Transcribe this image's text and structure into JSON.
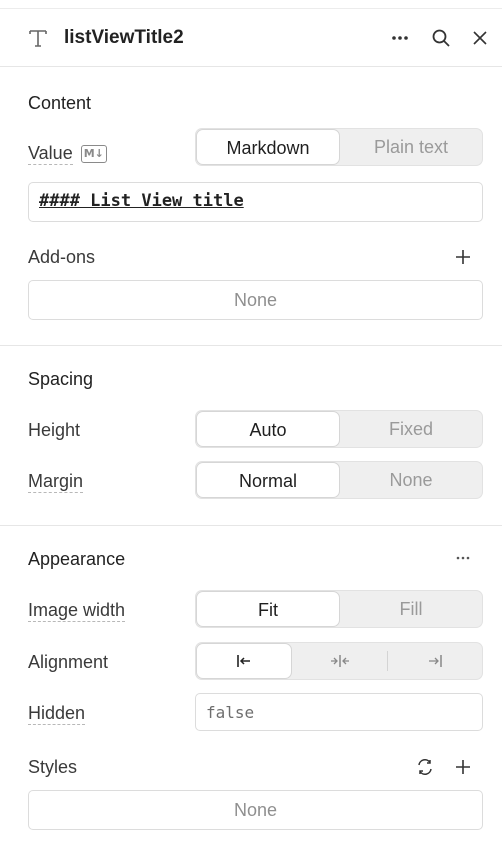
{
  "header": {
    "title": "listViewTitle2",
    "type_icon": "text-type-icon",
    "more_icon": "more-horizontal-icon",
    "search_icon": "search-icon",
    "close_icon": "close-icon"
  },
  "content": {
    "title": "Content",
    "value_label": "Value",
    "value_badge": "M↓",
    "value_modes": [
      "Markdown",
      "Plain text"
    ],
    "value_mode_selected": "Markdown",
    "value_text": "#### List View title",
    "addons_label": "Add-ons",
    "addons_value": "None"
  },
  "spacing": {
    "title": "Spacing",
    "height_label": "Height",
    "height_options": [
      "Auto",
      "Fixed"
    ],
    "height_selected": "Auto",
    "margin_label": "Margin",
    "margin_options": [
      "Normal",
      "None"
    ],
    "margin_selected": "Normal"
  },
  "appearance": {
    "title": "Appearance",
    "image_width_label": "Image width",
    "image_width_options": [
      "Fit",
      "Fill"
    ],
    "image_width_selected": "Fit",
    "alignment_label": "Alignment",
    "alignment_options": [
      "align-left-icon",
      "align-center-icon",
      "align-right-icon"
    ],
    "alignment_selected": "align-left-icon",
    "hidden_label": "Hidden",
    "hidden_value": "false",
    "styles_label": "Styles",
    "styles_value": "None"
  }
}
